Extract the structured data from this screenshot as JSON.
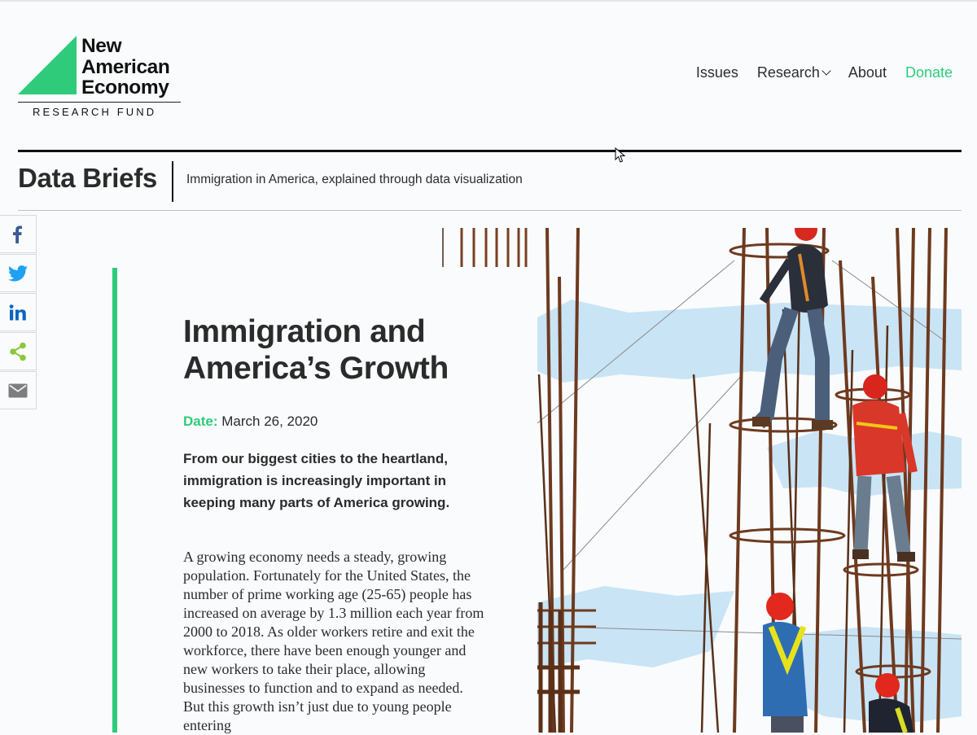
{
  "logo": {
    "line1": "New",
    "line2": "American",
    "line3": "Economy",
    "subtitle": "RESEARCH FUND"
  },
  "nav": {
    "issues": "Issues",
    "research": "Research",
    "about": "About",
    "donate": "Donate"
  },
  "section": {
    "title": "Data Briefs",
    "subtitle": "Immigration in America, explained through data visualization"
  },
  "share": {
    "icons": [
      "facebook-icon",
      "twitter-icon",
      "linkedin-icon",
      "share-icon",
      "email-icon"
    ]
  },
  "article": {
    "title": "Immigration and America’s Growth",
    "date_label": "Date:",
    "date": "March 26, 2020",
    "lede": "From our biggest cities to the heartland, immigration is increasingly important in keeping many parts of America growing.",
    "body": "A growing economy needs a steady, growing population. Fortunately for the United States, the number of prime working age (25-65) people has increased on average by 1.3 million each year from 2000 to 2018. As older workers retire and exit the workforce, there have been enough younger and new workers to take their place, allowing businesses to function and to expand as needed. But this growth isn’t just due to young people entering"
  },
  "colors": {
    "accent": "#2fcb7a",
    "text": "#2b2b2b",
    "background": "#f9fbfd"
  }
}
